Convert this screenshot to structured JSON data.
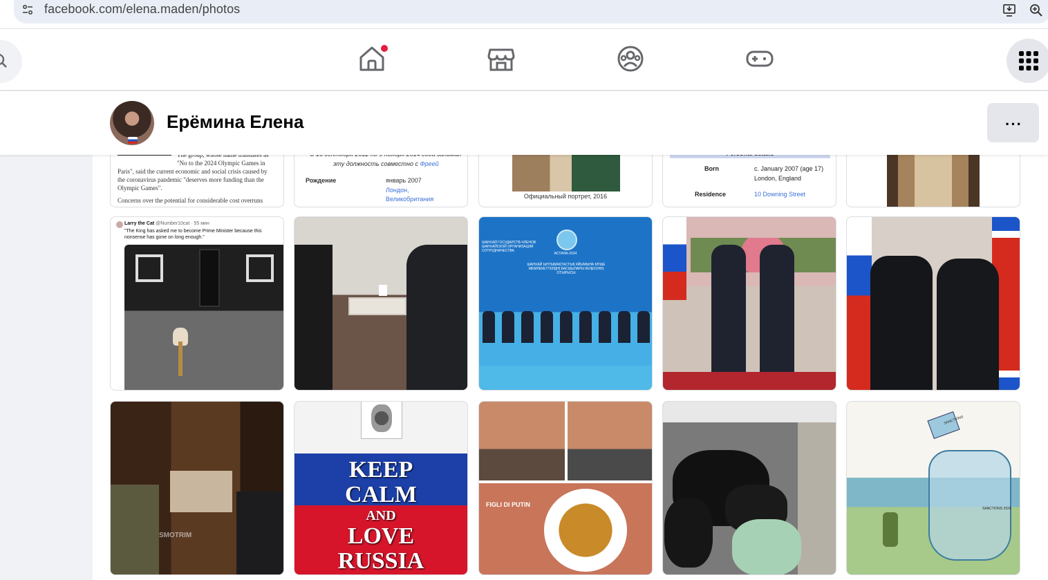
{
  "browser": {
    "url": "facebook.com/elena.maden/photos"
  },
  "nav": {
    "tabs": [
      "home-icon",
      "marketplace-icon",
      "groups-icon",
      "gaming-icon"
    ],
    "home_notification": true
  },
  "profile": {
    "name": "Ерёмина Елена",
    "more_label": "···"
  },
  "row1": {
    "card1": {
      "lines": [
        "The group, whose name translates as",
        "\"No to the 2024 Olympic Games in",
        "Paris\", said the current economic and social crisis caused by",
        "the coronavirus pandemic \"deserves more funding than the",
        "Olympic Games\".",
        "Concerns over the potential for considerable cost overruns"
      ]
    },
    "card2": {
      "line1": "С 16 сентября 2012 по 9 ноября 2014 года занимал",
      "line2": "эту должность совместно с",
      "line2_link": "Фреей",
      "label": "Рождение",
      "value1": "январь 2007",
      "value2": "Лондон,",
      "value3": "Великобритания"
    },
    "card3": {
      "caption": "Официальный портрет, 2016"
    },
    "card4": {
      "header": "Personal details",
      "born_label": "Born",
      "born_value1": "c. January 2007 (age 17)",
      "born_value2": "London, England",
      "residence_label": "Residence",
      "residence_value": "10 Downing Street"
    }
  },
  "row2": {
    "tweet": {
      "author": "Larry the Cat",
      "handle": "@Number10cat · 55 мин",
      "text": "\"The King has asked me to become Prime Minister because this nonsense has gone on long enough.\""
    },
    "summit": {
      "banner_left": "ШАНХАЙ ГОСУДАРСТВ-ЧЛЕНОВ ШАНХАЙСКОЙ ОРГАНИЗАЦИИ СОТРУДНИЧЕСТВА",
      "banner_city": "АСТАНА-2024",
      "banner_mid": "ШАНХАЙ ЫНТЫМАҚТАСТЫҚ ҰЙЫМЫНА МҮШЕ МЕМЛЕКЕТТЕРДІҢ БАСШЫЛАРЫ КЕҢЕСІНІҢ ОТЫРЫСЫ"
    }
  },
  "row3": {
    "poster": {
      "line1": "KEEP",
      "line2": "CALM",
      "line3": "AND",
      "line4": "LOVE",
      "line5": "RUSSIA"
    },
    "meme": {
      "watermark": "FIGLI DI PUTIN"
    },
    "cartoon": {
      "bag_label1": "SANCTIONS",
      "bag_label2": "SANCTIONS 2024"
    },
    "interview_watermark": "SMOTRIM"
  }
}
